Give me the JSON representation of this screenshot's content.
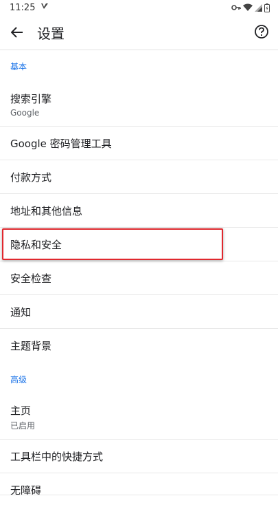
{
  "status": {
    "time": "11:25"
  },
  "toolbar": {
    "title": "设置"
  },
  "sections": {
    "basic": "基本",
    "advanced": "高级"
  },
  "items": {
    "search_engine": {
      "label": "搜索引擎",
      "value": "Google"
    },
    "password_manager": {
      "label": "Google 密码管理工具"
    },
    "payment": {
      "label": "付款方式"
    },
    "addresses": {
      "label": "地址和其他信息"
    },
    "privacy": {
      "label": "隐私和安全"
    },
    "safety_check": {
      "label": "安全检查"
    },
    "notifications": {
      "label": "通知"
    },
    "theme": {
      "label": "主题背景"
    },
    "homepage": {
      "label": "主页",
      "value": "已启用"
    },
    "toolbar_shortcut": {
      "label": "工具栏中的快捷方式"
    },
    "accessibility": {
      "label": "无障碍"
    }
  },
  "colors": {
    "accent": "#1a73e8",
    "highlight": "#e0282e"
  }
}
